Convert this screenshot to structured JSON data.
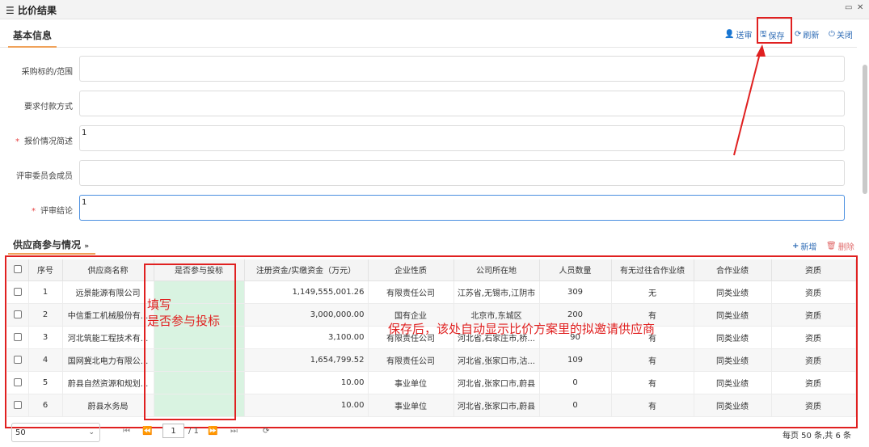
{
  "window": {
    "title": "比价结果",
    "menu_icon": "hamburger-icon",
    "maximize_icon": "maximize-icon",
    "close_icon": "close-icon"
  },
  "basic_info": {
    "section_label": "基本信息",
    "toolbar": {
      "submit_label": "送审",
      "save_label": "保存",
      "refresh_label": "刷新",
      "close_label": "关闭"
    },
    "fields": [
      {
        "label": "采购标的/范围",
        "required": false,
        "value": ""
      },
      {
        "label": "要求付款方式",
        "required": false,
        "value": ""
      },
      {
        "label": "报价情况简述",
        "required": true,
        "value": "1"
      },
      {
        "label": "评审委员会成员",
        "required": false,
        "value": ""
      },
      {
        "label": "评审结论",
        "required": true,
        "value": "1"
      }
    ],
    "required_mark": "*"
  },
  "suppliers": {
    "section_label": "供应商参与情况",
    "collapse_icon": "double-chevron-down-icon",
    "add_label": "新增",
    "delete_label": "删除",
    "columns": [
      "序号",
      "供应商名称",
      "是否参与投标",
      "注册资金/实缴资金（万元）",
      "企业性质",
      "公司所在地",
      "人员数量",
      "有无过往合作业绩",
      "合作业绩",
      "资质"
    ],
    "rows": [
      {
        "no": "1",
        "name": "远景能源有限公司",
        "bid": "",
        "capital": "1,149,555,001.26",
        "nature": "有限责任公司",
        "location": "江苏省,无锡市,江阴市",
        "staff": "309",
        "history": "无",
        "perf": "同类业绩",
        "qual": "资质"
      },
      {
        "no": "2",
        "name": "中信重工机械股份有...",
        "bid": "",
        "capital": "3,000,000.00",
        "nature": "国有企业",
        "location": "北京市,东城区",
        "staff": "200",
        "history": "有",
        "perf": "同类业绩",
        "qual": "资质"
      },
      {
        "no": "3",
        "name": "河北筑能工程技术有...",
        "bid": "",
        "capital": "3,100.00",
        "nature": "有限责任公司",
        "location": "河北省,石家庄市,桥...",
        "staff": "90",
        "history": "有",
        "perf": "同类业绩",
        "qual": "资质"
      },
      {
        "no": "4",
        "name": "国网冀北电力有限公...",
        "bid": "",
        "capital": "1,654,799.52",
        "nature": "有限责任公司",
        "location": "河北省,张家口市,沽...",
        "staff": "109",
        "history": "有",
        "perf": "同类业绩",
        "qual": "资质"
      },
      {
        "no": "5",
        "name": "蔚县自然资源和规划...",
        "bid": "",
        "capital": "10.00",
        "nature": "事业单位",
        "location": "河北省,张家口市,蔚县",
        "staff": "0",
        "history": "有",
        "perf": "同类业绩",
        "qual": "资质"
      },
      {
        "no": "6",
        "name": "蔚县水务局",
        "bid": "",
        "capital": "10.00",
        "nature": "事业单位",
        "location": "河北省,张家口市,蔚县",
        "staff": "0",
        "history": "有",
        "perf": "同类业绩",
        "qual": "资质"
      }
    ]
  },
  "pager": {
    "page_size": "50",
    "page": "1",
    "total_pages": "/ 1",
    "info": "每页 50 条,共 6 条"
  },
  "annotations": {
    "fill_line1": "填写",
    "fill_line2": "是否参与投标",
    "auto_note": "保存后，该处自动显示比价方案里的拟邀请供应商"
  },
  "colors": {
    "annotation_red": "#e02020",
    "link_blue": "#2d6bb5",
    "highlight_green": "#d9f3e1",
    "tab_accent": "#f0a25a"
  }
}
